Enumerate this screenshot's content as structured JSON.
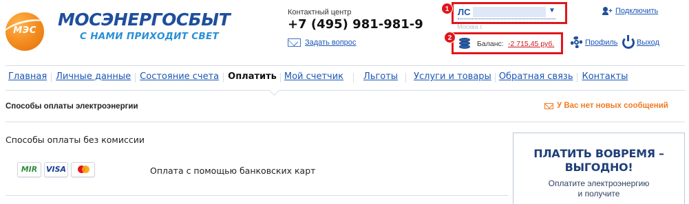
{
  "brand": {
    "logo_text": "МЭС",
    "name": "МОСЭНЕРГОСБЫТ",
    "slogan": "С НАМИ ПРИХОДИТ СВЕТ"
  },
  "contact": {
    "label": "Контактный центр",
    "phone": "+7 (495) 981-981-9",
    "ask_link": "Задать вопрос"
  },
  "account": {
    "label": "ЛС",
    "city": "Москва г."
  },
  "badges": [
    "1",
    "2"
  ],
  "balance": {
    "label": "Баланс:",
    "value": "-2 715,45 руб."
  },
  "user_links": {
    "connect": "Подключить",
    "profile": "Профиль",
    "logout": "Выход"
  },
  "nav": {
    "items": [
      {
        "label": "Главная",
        "active": false
      },
      {
        "label": "Личные данные",
        "active": false
      },
      {
        "label": "Состояние счета",
        "active": false
      },
      {
        "label": "Оплатить",
        "active": true
      },
      {
        "label": "Мой счетчик",
        "active": false
      },
      {
        "label": "Льготы",
        "active": false
      },
      {
        "label": "Услуги и товары",
        "active": false
      },
      {
        "label": "Обратная связь",
        "active": false
      },
      {
        "label": "Контакты",
        "active": false
      }
    ]
  },
  "page": {
    "title": "Способы оплаты электроэнергии",
    "messages": "У Вас нет новых сообщений",
    "section_title": "Способы оплаты без комиссии",
    "cards": [
      "MIR",
      "VISA",
      "Mastercard"
    ],
    "pay_method": "Оплата с помощью банковских карт"
  },
  "promo": {
    "headline_1": "ПЛАТИТЬ ВОВРЕМЯ –",
    "headline_2": "ВЫГОДНО!",
    "text_1": "Оплатите электроэнергию",
    "text_2": "и получите"
  },
  "colors": {
    "link": "#1a56b5",
    "highlight": "#e0151b",
    "accent_orange": "#f07a21",
    "brand_blue": "#1f4f9c"
  }
}
